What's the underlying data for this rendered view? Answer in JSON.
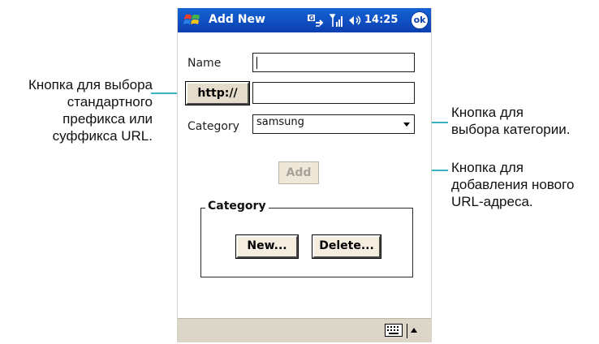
{
  "titlebar": {
    "app_title": "Add New",
    "clock": "14:25",
    "ok_label": "ok"
  },
  "form": {
    "name_label": "Name",
    "name_value": "",
    "prefix_button_label": "http://",
    "url_value": "",
    "category_label": "Category",
    "category_selected": "samsung",
    "add_button_label": "Add"
  },
  "category_group": {
    "legend": "Category",
    "new_button_label": "New...",
    "delete_button_label": "Delete..."
  },
  "callouts": {
    "prefix": [
      "Кнопка для выбора",
      "стандартного",
      "префикса или",
      "суффикса URL."
    ],
    "category": [
      "Кнопка для",
      "выбора категории."
    ],
    "add": [
      "Кнопка для",
      "добавления нового",
      "URL-адреса."
    ]
  },
  "icons": {
    "start": "windows-flag-icon",
    "sync": "sync-icon",
    "signal": "signal-icon",
    "volume": "volume-icon",
    "keyboard": "keyboard-icon"
  },
  "colors": {
    "titlebar": "#0b3fb0",
    "leader_line": "#3bb3c3",
    "menubar": "#dcd6c9"
  }
}
